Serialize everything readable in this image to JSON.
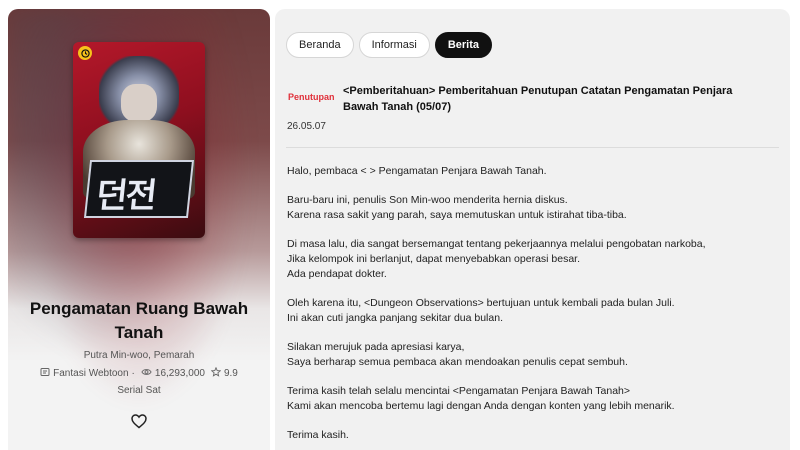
{
  "series": {
    "title": "Pengamatan Ruang Bawah Tanah",
    "authors": "Putra Min-woo, Pemarah",
    "genre": "Fantasi Webtoon",
    "views": "16,293,000",
    "rating": "9.9",
    "schedule": "Serial Sat",
    "cover_art_text": "던전"
  },
  "tabs": [
    {
      "label": "Beranda",
      "active": false
    },
    {
      "label": "Informasi",
      "active": false
    },
    {
      "label": "Berita",
      "active": true
    }
  ],
  "notice": {
    "tag": "Penutupan",
    "title": "<Pemberitahuan> Pemberitahuan Penutupan Catatan Pengamatan Penjara Bawah Tanah (05/07)",
    "date": "26.05.07",
    "paragraphs": [
      [
        "Halo, pembaca < > Pengamatan Penjara Bawah Tanah."
      ],
      [
        "Baru-baru ini, penulis Son Min-woo menderita hernia diskus.",
        "Karena rasa sakit yang parah, saya memutuskan untuk istirahat tiba-tiba."
      ],
      [
        "Di masa lalu, dia sangat bersemangat tentang pekerjaannya melalui pengobatan narkoba,",
        "Jika kelompok ini berlanjut, dapat menyebabkan operasi besar.",
        "Ada pendapat dokter."
      ],
      [
        "Oleh karena itu, <Dungeon Observations> bertujuan untuk kembali pada bulan Juli.",
        "Ini akan cuti jangka panjang sekitar dua bulan."
      ],
      [
        "Silakan merujuk pada apresiasi karya,",
        "Saya berharap semua pembaca akan mendoakan penulis cepat sembuh."
      ],
      [
        "Terima kasih telah selalu mencintai <Pengamatan Penjara Bawah Tanah>",
        "Kami akan mencoba bertemu lagi dengan Anda dengan konten yang lebih menarik."
      ],
      [
        "Terima kasih."
      ]
    ]
  },
  "colors": {
    "accent_red": "#e0303a",
    "active_tab": "#111111",
    "badge_yellow": "#f7c21b"
  },
  "icons": {
    "genre": "book-icon",
    "views": "eye-icon",
    "rating": "star-icon",
    "favorite": "heart-icon",
    "badge": "clock-icon"
  }
}
